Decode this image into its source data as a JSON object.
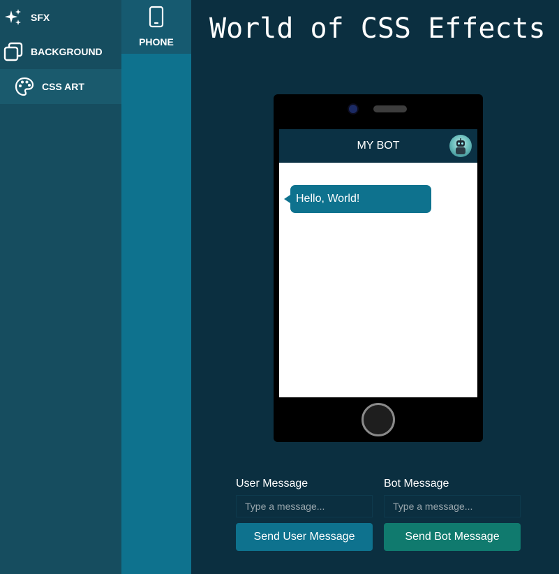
{
  "nav": {
    "items": [
      {
        "label": "SFX",
        "icon": "sparkles-icon"
      },
      {
        "label": "BACKGROUND",
        "icon": "copy-squares-icon"
      },
      {
        "label": "CSS ART",
        "icon": "palette-icon"
      }
    ]
  },
  "subnav": {
    "items": [
      {
        "label": "PHONE",
        "icon": "phone-icon"
      }
    ]
  },
  "page": {
    "title": "World of CSS Effects"
  },
  "phone": {
    "header_title": "MY BOT",
    "messages": [
      {
        "from": "bot",
        "text": "Hello, World!"
      }
    ]
  },
  "controls": {
    "user": {
      "label": "User Message",
      "placeholder": "Type a message...",
      "button": "Send User Message"
    },
    "bot": {
      "label": "Bot Message",
      "placeholder": "Type a message...",
      "button": "Send Bot Message"
    }
  },
  "colors": {
    "background": "#0b2f40",
    "nav": "#164d5f",
    "subnav": "#0e728e",
    "user_button": "#0e728e",
    "bot_button": "#107a6e"
  }
}
